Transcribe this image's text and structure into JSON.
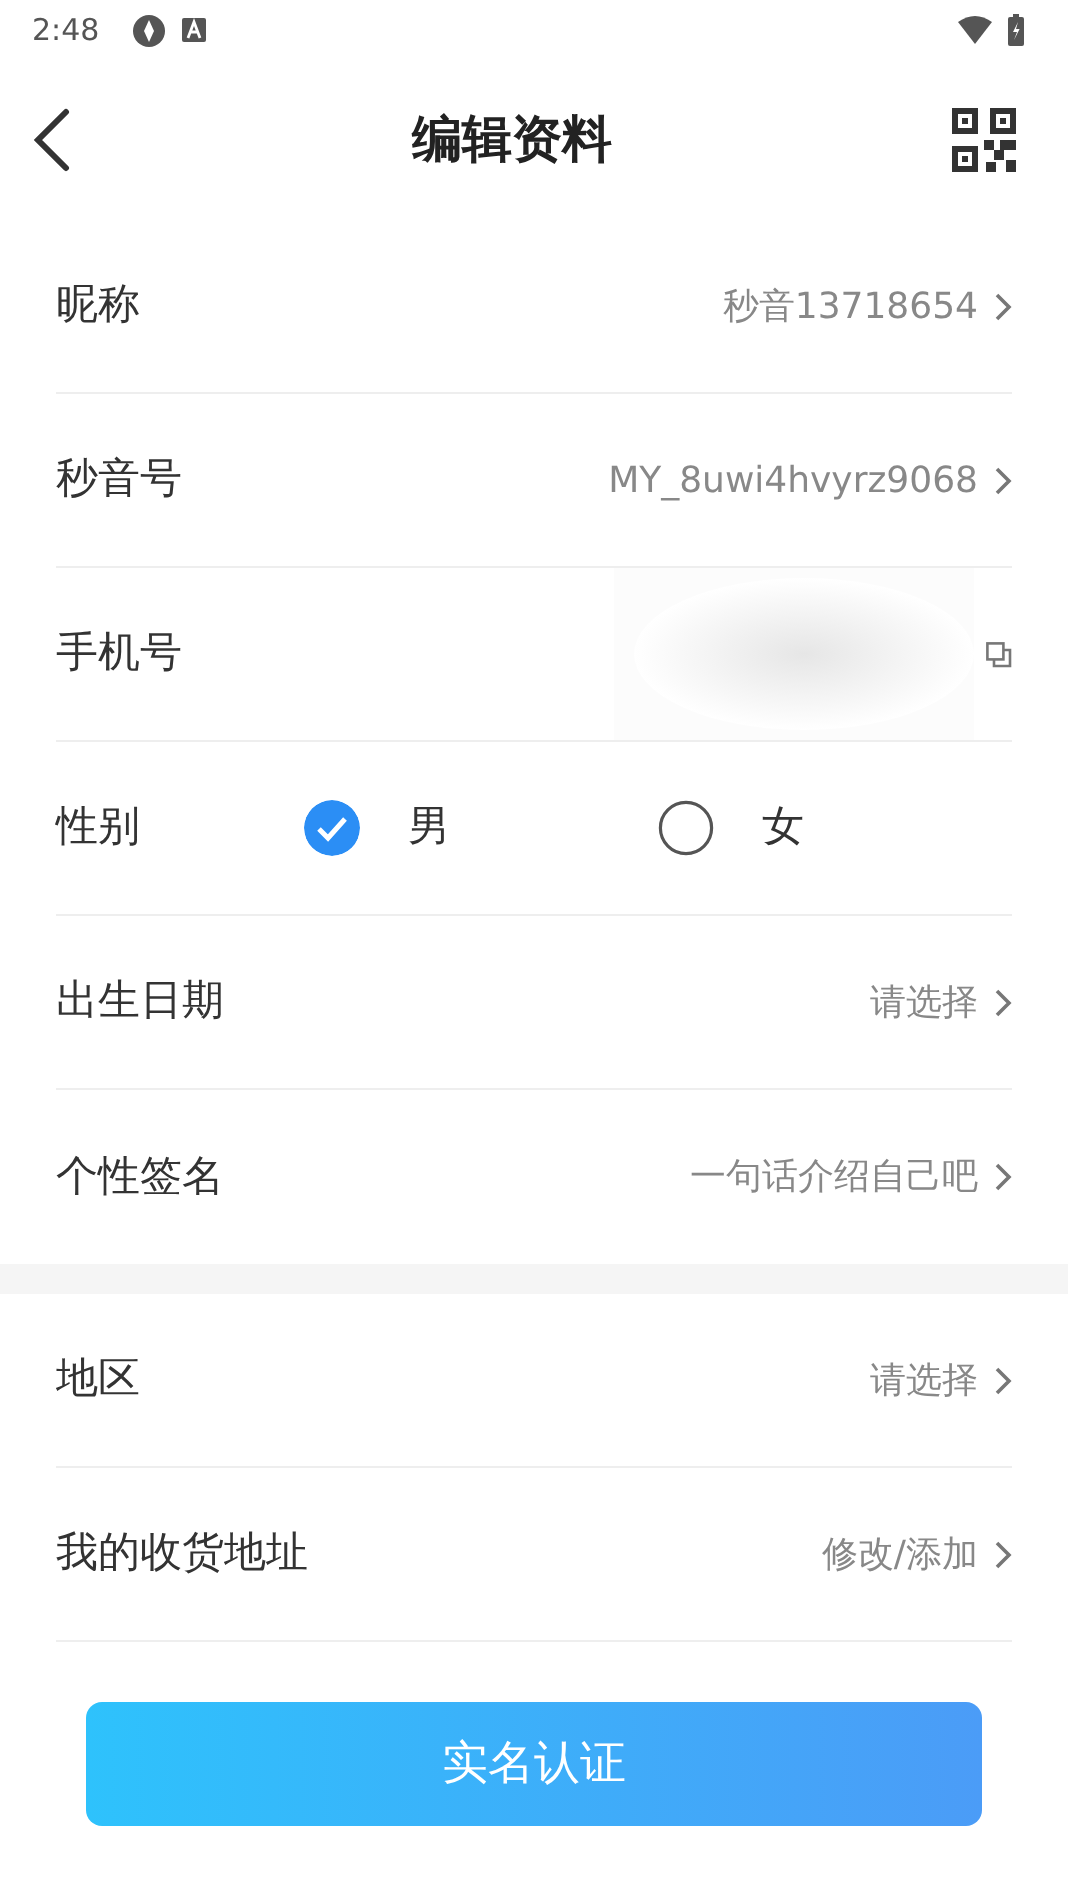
{
  "status_bar": {
    "time": "2:48"
  },
  "header": {
    "title": "编辑资料"
  },
  "sections": [
    {
      "rows": [
        {
          "kind": "link",
          "label": "昵称",
          "value": "秒音13718654"
        },
        {
          "kind": "link",
          "label": "秒音号",
          "value": "MY_8uwi4hvyrz9068"
        },
        {
          "kind": "copy",
          "label": "手机号"
        },
        {
          "kind": "gender",
          "label": "性别",
          "options": [
            {
              "label": "男",
              "selected": true
            },
            {
              "label": "女",
              "selected": false
            }
          ]
        },
        {
          "kind": "link",
          "label": "出生日期",
          "value": "请选择"
        },
        {
          "kind": "link",
          "label": "个性签名",
          "value": "一句话介绍自己吧"
        }
      ]
    },
    {
      "rows": [
        {
          "kind": "link",
          "label": "地区",
          "value": "请选择"
        },
        {
          "kind": "link",
          "label": "我的收货地址",
          "value": "修改/添加"
        }
      ]
    }
  ],
  "action_button": {
    "label": "实名认证"
  }
}
